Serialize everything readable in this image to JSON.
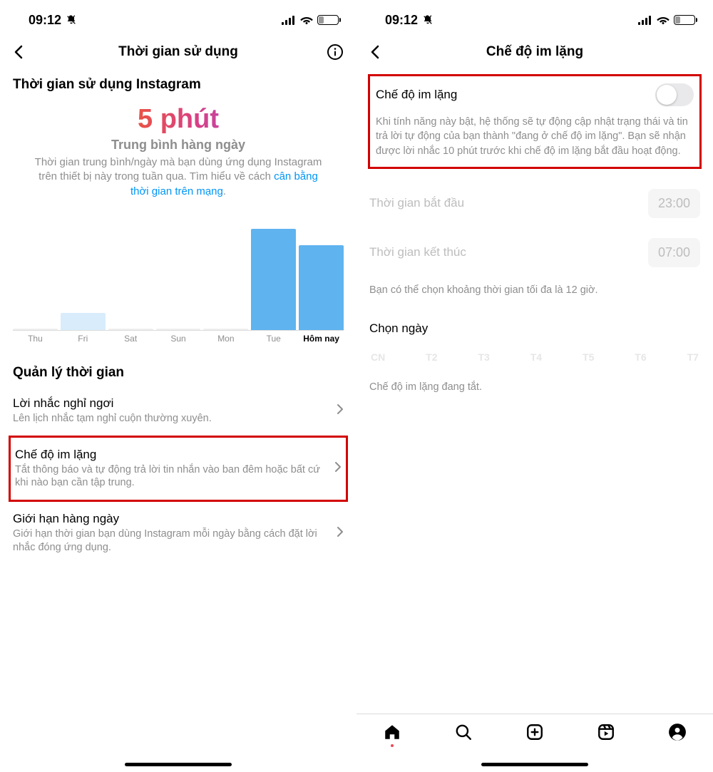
{
  "status": {
    "time": "09:12",
    "battery_pct": "26",
    "battery_fill_css": "26%"
  },
  "screenA": {
    "nav_title": "Thời gian sử dụng",
    "section_title": "Thời gian sử dụng Instagram",
    "big_number": "5 phút",
    "avg_label": "Trung bình hàng ngày",
    "avg_desc_1": "Thời gian trung bình/ngày mà bạn dùng ứng dụng Instagram trên thiết bị này trong tuần qua. Tìm hiểu về cách ",
    "avg_link": "cân bằng thời gian trên mạng",
    "avg_desc_2": ".",
    "manage_title": "Quản lý thời gian",
    "rows": [
      {
        "title": "Lời nhắc nghỉ ngơi",
        "sub": "Lên lịch nhắc tạm nghỉ cuộn thường xuyên."
      },
      {
        "title": "Chế độ im lặng",
        "sub": "Tắt thông báo và tự động trả lời tin nhắn vào ban đêm hoặc bất cứ khi nào bạn cần tập trung."
      },
      {
        "title": "Giới hạn hàng ngày",
        "sub": "Giới hạn thời gian bạn dùng Instagram mỗi ngày bằng cách đặt lời nhắc đóng ứng dụng."
      }
    ]
  },
  "screenB": {
    "nav_title": "Chế độ im lặng",
    "toggle_label": "Chế độ im lặng",
    "toggle_on": false,
    "desc": "Khi tính năng này bật, hệ thống sẽ tự động cập nhật trạng thái và tin trả lời tự động của bạn thành \"đang ở chế độ im lặng\". Bạn sẽ nhận được lời nhắc 10 phút trước khi chế độ im lặng bắt đầu hoạt động.",
    "start_label": "Thời gian bắt đầu",
    "start_value": "23:00",
    "end_label": "Thời gian kết thúc",
    "end_value": "07:00",
    "time_note": "Bạn có thể chọn khoảng thời gian tối đa là 12 giờ.",
    "choose_day": "Chọn ngày",
    "days": [
      "CN",
      "T2",
      "T3",
      "T4",
      "T5",
      "T6",
      "T7"
    ],
    "quiet_off": "Chế độ im lặng đang tắt."
  },
  "chart_data": {
    "type": "bar",
    "title": "Thời gian sử dụng Instagram",
    "ylabel": "phút",
    "categories": [
      "Thu",
      "Fri",
      "Sat",
      "Sun",
      "Mon",
      "Tue",
      "Hôm nay"
    ],
    "values": [
      0,
      3,
      0,
      0,
      0,
      18,
      15
    ],
    "today_index": 6,
    "ylim": [
      0,
      20
    ],
    "colors": {
      "default": "#d8ecfb",
      "high": "#5fb3ee"
    }
  }
}
